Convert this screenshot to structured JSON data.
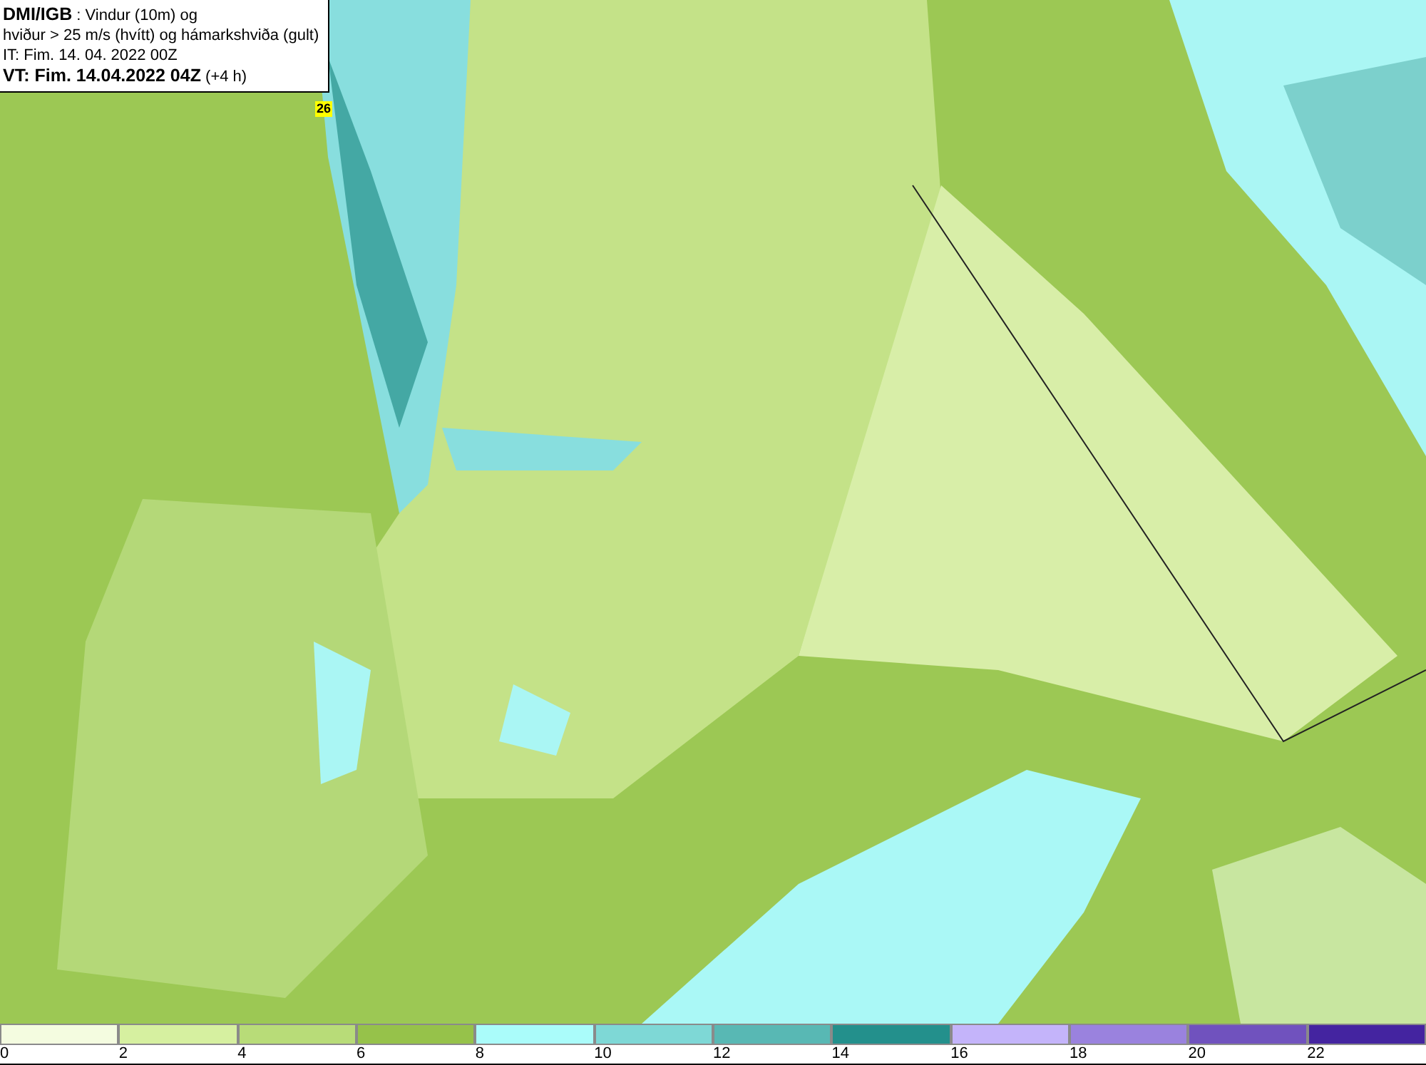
{
  "header": {
    "source": "DMI/IGB",
    "title": ": Vindur (10m) og",
    "subtitle": "hviður > 25 m/s (hvítt) og hámarkshviða (gult)",
    "initial_time": "IT: Fim. 14. 04. 2022 00Z",
    "valid_time": "VT: Fim. 14.04.2022 04Z",
    "lead": "(+4 h)"
  },
  "gust_labels": [
    {
      "value": "26"
    }
  ],
  "legend": [
    {
      "label": "0",
      "color": "#f4fce0"
    },
    {
      "label": "2",
      "color": "#d6f0a0"
    },
    {
      "label": "4",
      "color": "#b8dc78"
    },
    {
      "label": "6",
      "color": "#96c24a"
    },
    {
      "label": "8",
      "color": "#aafcfa"
    },
    {
      "label": "10",
      "color": "#7ed8d6"
    },
    {
      "label": "12",
      "color": "#58b8b4"
    },
    {
      "label": "14",
      "color": "#23908c"
    },
    {
      "label": "16",
      "color": "#c4b4fa"
    },
    {
      "label": "18",
      "color": "#9a82de"
    },
    {
      "label": "20",
      "color": "#7052be"
    },
    {
      "label": "22",
      "color": "#4424a0"
    }
  ]
}
